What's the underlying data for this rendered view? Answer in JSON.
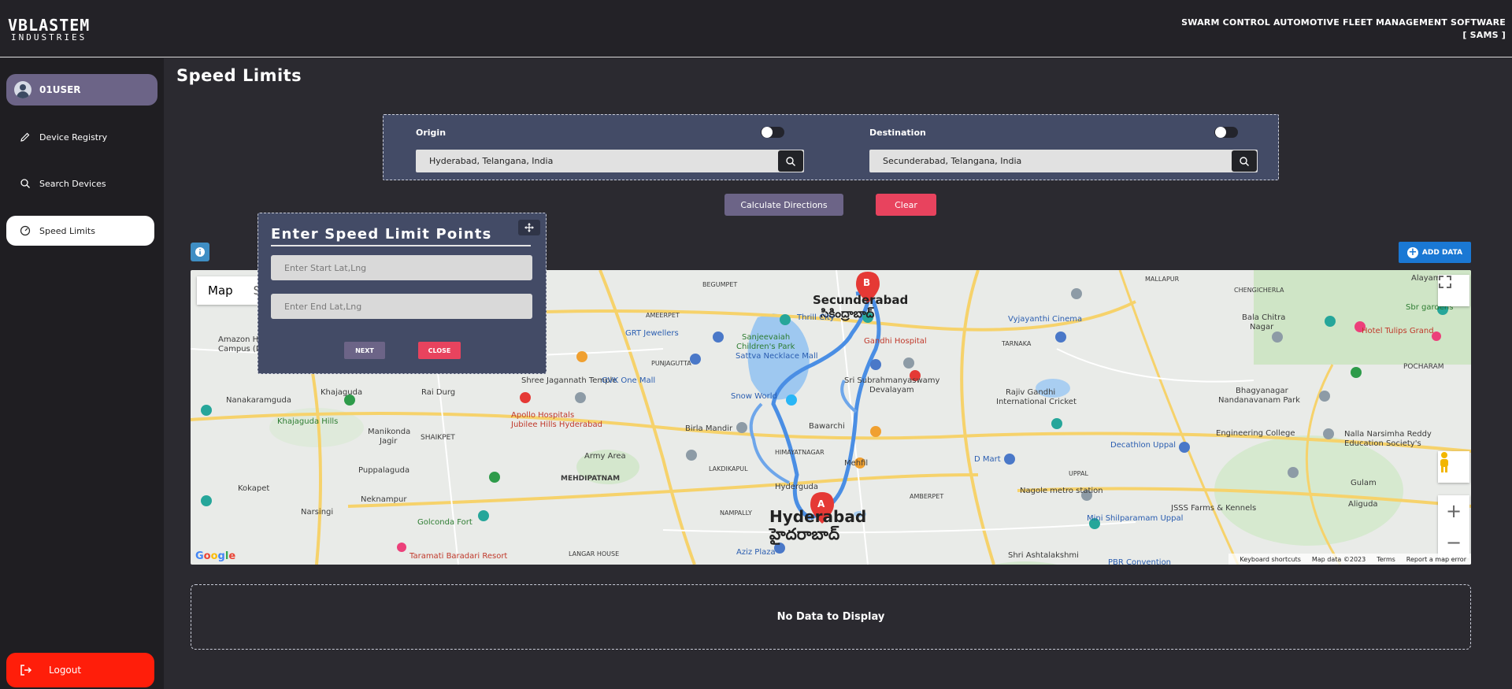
{
  "header": {
    "logo_line1": "VBLASTEM",
    "logo_line2": "INDUSTRIES",
    "app_title_line1": "SWARM CONTROL AUTOMOTIVE FLEET MANAGEMENT SOFTWARE",
    "app_title_line2": "[ SAMS ]"
  },
  "sidebar": {
    "user_name": "01USER",
    "items": [
      {
        "label": "Device Registry",
        "icon": "pencil-icon"
      },
      {
        "label": "Search Devices",
        "icon": "search-icon"
      },
      {
        "label": "Speed Limits",
        "icon": "gauge-icon",
        "active": true
      }
    ],
    "logout_label": "Logout"
  },
  "page": {
    "title": "Speed Limits"
  },
  "route": {
    "origin_label": "Origin",
    "origin_value": "Hyderabad, Telangana, India",
    "destination_label": "Destination",
    "destination_value": "Secunderabad, Telangana, India",
    "calculate_label": "Calculate Directions",
    "clear_label": "Clear"
  },
  "toolbar": {
    "add_data_label": "ADD DATA"
  },
  "map": {
    "map_type_label": "Map",
    "map_type_partial": "S",
    "attribution": [
      "Keyboard shortcuts",
      "Map data ©2023",
      "Terms",
      "Report a map error"
    ],
    "logo": "Google",
    "marker_a": "A",
    "marker_b": "B",
    "labels": {
      "secunderabad": "Secunderabad",
      "secunderabad_te": "సికింద్రాబాద్",
      "hyderabad": "Hyderabad",
      "hyderabad_te": "హైదరాబాద్",
      "begumpet": "BEGUMPET",
      "ameerpet": "AMEERPET",
      "punjagutta": "PUNJAGUTTA",
      "thrill_city": "Thrill City",
      "grt_jewellers": "GRT Jewellers",
      "sanjeevaiah": "Sanjeevaiah",
      "childrens_park": "Children's Park",
      "sattva_necklace": "Sattva Necklace Mall",
      "gandhi_hospital": "Gandhi Hospital",
      "vyjayanthi": "Vyjayanthi Cinema",
      "bala_chitra": "Bala Chitra",
      "nagar": "Nagar",
      "tarnaka": "TARNAKA",
      "hotel_tulips": "Hotel Tulips Grand",
      "sbr_gardens": "Sbr gardens",
      "pocharam": "POCHARAM",
      "malkajgiri": "MALLAPUR",
      "chengicherla": "CHENGICHERLA",
      "alayam": "Alayam",
      "amazon": "Amazon Hyde",
      "campus": "Campus (B",
      "nanakaramguda": "Nanakaramguda",
      "khajaguda": "Khajaguda",
      "rai_durg": "Rai Durg",
      "shree_jagannath": "Shree Jagannath Temple",
      "gvk_one": "GVK One Mall",
      "snow_world": "Snow World",
      "sri_subrahmanyaswamy": "Sri Subrahmanyaswamy",
      "devalayam": "Devalayam",
      "rajiv_gandhi": "Rajiv Gandhi",
      "intl_cricket": "International Cricket",
      "bhagyanagar": "Bhagyanagar",
      "nandanavanam": "Nandanavanam Park",
      "apollo": "Apollo Hospitals",
      "jubilee_hills": "Jubilee Hills Hyderabad",
      "khajaguda_hills": "Khajaguda Hills",
      "manikonda": "Manikonda",
      "jagir": "Jagir",
      "shaikpet": "SHAIKPET",
      "birla_mandir": "Birla Mandir",
      "bawarchi": "Bawarchi",
      "himayatnagar": "HIMAYATNAGAR",
      "mehfil": "Mehfil",
      "d_mart": "D Mart",
      "decathlon": "Decathlon Uppal",
      "engineering_college": "Engineering College",
      "nalla_narsimha": "Nalla Narsimha Reddy",
      "education_society": "Education Society's",
      "army_area": "Army Area",
      "mehdipatnam": "MEHDIPATNAM",
      "lakdikapul": "LAKDIKAPUL",
      "puppalaguda": "Puppalaguda",
      "kokapet": "Kokapet",
      "neknampur": "Neknampur",
      "narsingi": "Narsingi",
      "golconda": "Golconda Fort",
      "taramati": "Taramati Baradari Resort",
      "nampally": "NAMPALLY",
      "aziz_plaza": "Aziz Plaza",
      "amberpet": "AMBERPET",
      "nagole": "Nagole metro station",
      "mini_shilparamam": "Mini Shilparamam Uppal",
      "jsss_farms": "JSSS Farms & Kennels",
      "gulam": "Gulam",
      "ali_guda": "Aliguda",
      "shri_ashtalakshmi": "Shri Ashtalakshmi",
      "pbr": "PBR Convention",
      "langar_house": "LANGAR HOUSE",
      "uppal": "UPPAL",
      "hyderguda": "Hyderguda"
    }
  },
  "speed_popup": {
    "title": "Enter Speed Limit Points",
    "start_placeholder": "Enter Start Lat,Lng",
    "end_placeholder": "Enter End Lat,Lng",
    "next_label": "NEXT",
    "close_label": "CLOSE"
  },
  "table": {
    "empty_text": "No Data to Display"
  },
  "colors": {
    "accent": "#6c6487",
    "danger": "#e8435e",
    "logout": "#ff1e0a",
    "panel": "#434b66",
    "primary_blue": "#1a78d4",
    "route": "#4a8ee4",
    "marker": "#e53935"
  }
}
